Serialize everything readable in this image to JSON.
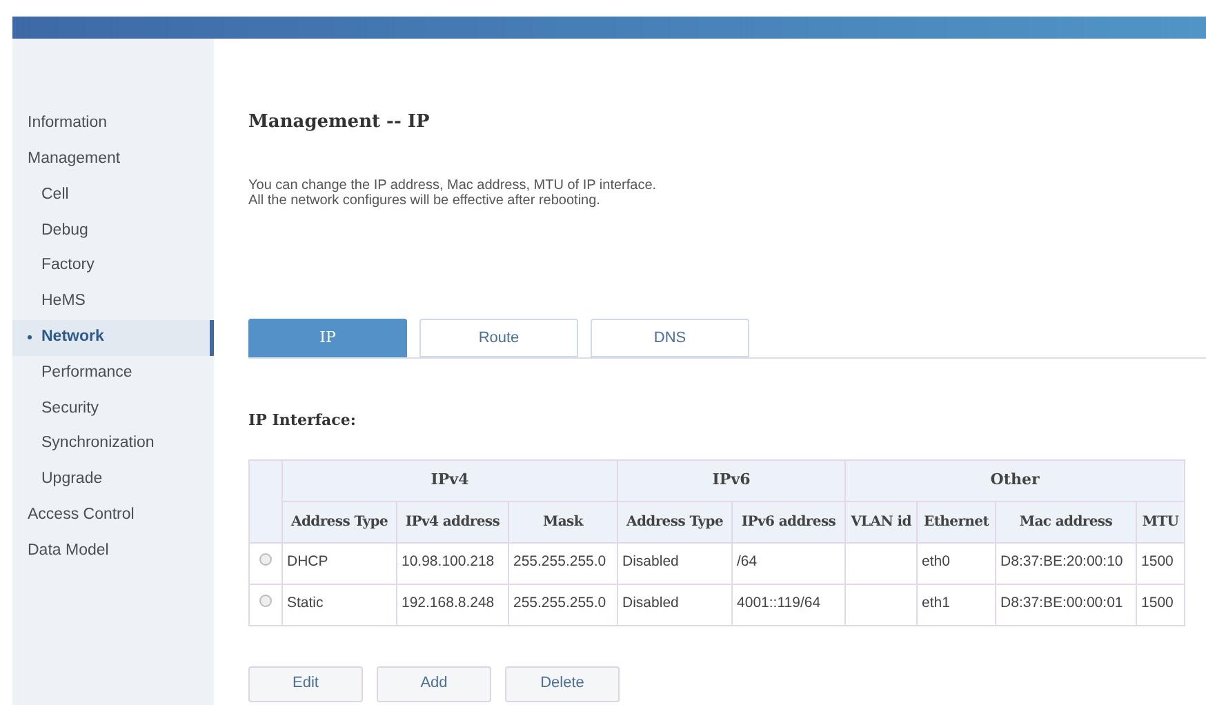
{
  "sidebar": {
    "items": [
      {
        "label": "Information",
        "selected": false
      },
      {
        "label": "Management",
        "selected": false,
        "children": [
          {
            "label": "Cell",
            "selected": false
          },
          {
            "label": "Debug",
            "selected": false
          },
          {
            "label": "Factory",
            "selected": false
          },
          {
            "label": "HeMS",
            "selected": false
          },
          {
            "label": "Network",
            "selected": true
          },
          {
            "label": "Performance",
            "selected": false
          },
          {
            "label": "Security",
            "selected": false
          },
          {
            "label": "Synchronization",
            "selected": false
          },
          {
            "label": "Upgrade",
            "selected": false
          }
        ]
      },
      {
        "label": "Access Control",
        "selected": false
      },
      {
        "label": "Data Model",
        "selected": false
      }
    ]
  },
  "page": {
    "title": "Management -- IP",
    "description": [
      "You can change the IP address, Mac address, MTU of IP interface.",
      "All the network configures will be effective after rebooting."
    ]
  },
  "tabs": [
    {
      "label": "IP",
      "selected": true
    },
    {
      "label": "Route",
      "selected": false
    },
    {
      "label": "DNS",
      "selected": false
    }
  ],
  "section_title": "IP Interface:",
  "table": {
    "groups": [
      "IPv4",
      "IPv6",
      "Other"
    ],
    "columns": [
      "Address Type",
      "IPv4 address",
      "Mask",
      "Address Type",
      "IPv6 address",
      "VLAN id",
      "Ethernet",
      "Mac address",
      "MTU"
    ],
    "rows": [
      {
        "selected": false,
        "cells": [
          "DHCP",
          "10.98.100.218",
          "255.255.255.0",
          "Disabled",
          "/64",
          "",
          "eth0",
          "D8:37:BE:20:00:10",
          "1500"
        ]
      },
      {
        "selected": false,
        "cells": [
          "Static",
          "192.168.8.248",
          "255.255.255.0",
          "Disabled",
          "4001::119/64",
          "",
          "eth1",
          "D8:37:BE:00:00:01",
          "1500"
        ]
      }
    ]
  },
  "buttons": [
    "Edit",
    "Add",
    "Delete"
  ]
}
